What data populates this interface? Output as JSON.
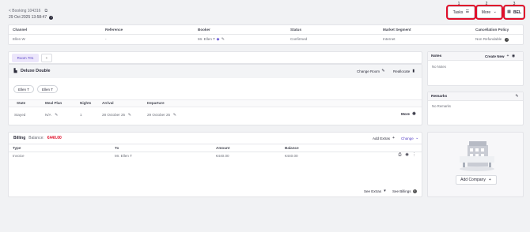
{
  "breadcrumb": "< Booking 104316",
  "created": "29 Oct 2025 13:58:47",
  "toolbar": {
    "tasks_label": "Tasks",
    "more_label": "More",
    "bel_label": "BEL",
    "markers": [
      "1",
      "2",
      "3"
    ]
  },
  "booking": {
    "headers": [
      "Channel",
      "Reference",
      "Booker",
      "Status",
      "Market Segment",
      "Cancellation Policy"
    ],
    "values": [
      "Ellen W",
      "-",
      "Mr. Ellen T",
      "Confirmed",
      "Internet",
      "Non Refundable"
    ]
  },
  "room_tabs": {
    "active": "Room 701",
    "add": "+"
  },
  "room": {
    "type": "Deluxe Double",
    "change_room": "Change Room",
    "reallocate": "Reallocate",
    "guests": [
      "Ellen T",
      "Ellen T"
    ],
    "headers": [
      "State",
      "Meal Plan",
      "Nights",
      "Arrival",
      "Departure"
    ],
    "values": [
      "Stayed",
      "N/A",
      "1",
      "28 October 25",
      "29 October 25"
    ],
    "more": "More"
  },
  "billing": {
    "title": "Billing",
    "balance_label": "Balance:",
    "balance_value": "€440.00",
    "add_extras": "Add Extras",
    "change": "Change",
    "headers": [
      "Type",
      "To",
      "Amount",
      "Balance"
    ],
    "rows": [
      {
        "type": "Invoice",
        "to": "Mr. Ellen T",
        "amount": "€440.00",
        "balance": "€440.00"
      }
    ],
    "see_extras": "See Extras",
    "see_billings": "See Billings"
  },
  "notes": {
    "title": "Notes",
    "create_new": "Create New",
    "empty": "No Notes"
  },
  "remarks": {
    "title": "Remarks",
    "empty": "No Remarks"
  },
  "company": {
    "add_label": "Add Company"
  },
  "colors": {
    "highlight": "#e0102b",
    "balance": "#e0102b",
    "active_tab": "#ece6fb"
  }
}
